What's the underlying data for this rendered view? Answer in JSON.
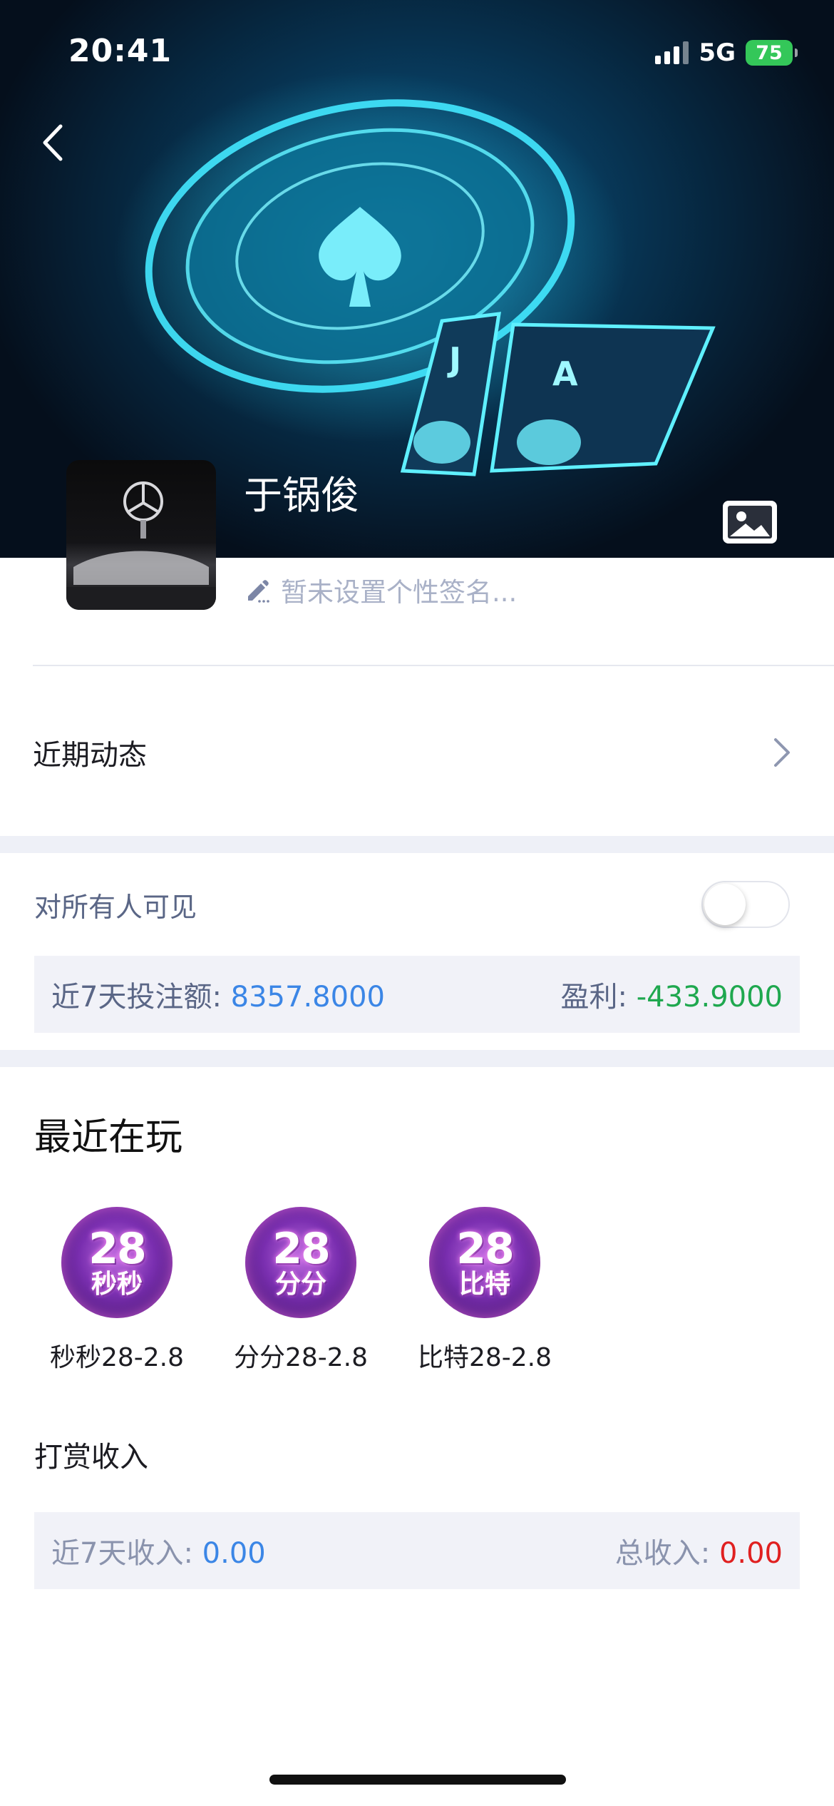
{
  "status_bar": {
    "time": "20:41",
    "network": "5G",
    "battery": "75"
  },
  "profile": {
    "name": "于锅俊",
    "signature_placeholder": "暂未设置个性签名..."
  },
  "recent_activity": {
    "label": "近期动态"
  },
  "visibility": {
    "label": "对所有人可见",
    "enabled": false
  },
  "bet_stats": {
    "label": "近7天投注额:",
    "value": "8357.8000",
    "profit_label": "盈利:",
    "profit_value": "-433.9000"
  },
  "recent_games": {
    "title": "最近在玩",
    "items": [
      {
        "icon_top": "28",
        "icon_bottom": "秒秒",
        "name": "秒秒28-2.8"
      },
      {
        "icon_top": "28",
        "icon_bottom": "分分",
        "name": "分分28-2.8"
      },
      {
        "icon_top": "28",
        "icon_bottom": "比特",
        "name": "比特28-2.8"
      }
    ]
  },
  "tip_income": {
    "title": "打赏收入",
    "week_label": "近7天收入:",
    "week_value": "0.00",
    "total_label": "总收入:",
    "total_value": "0.00"
  },
  "colors": {
    "accent_blue": "#3b86e6",
    "profit_green": "#1fa84f",
    "total_red": "#e02020",
    "battery_green": "#34c759"
  }
}
